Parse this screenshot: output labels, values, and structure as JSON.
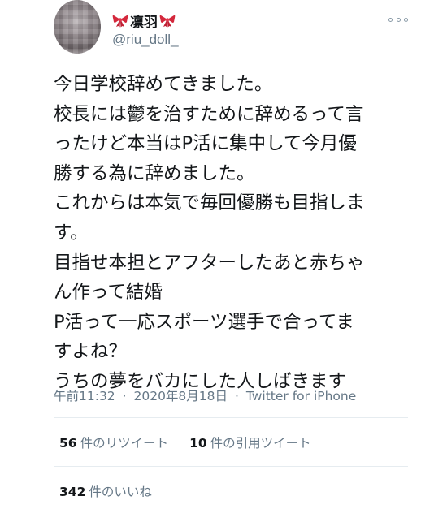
{
  "user": {
    "display_name": "凛羽",
    "handle": "@riu_doll_",
    "avatar_icon": "blurred-avatar",
    "ribbon_icon": "red-ribbon-emoji",
    "ribbon_color": "#d4283c"
  },
  "more_icon": "more-options-dots-icon",
  "tweet": {
    "lines": [
      "今日学校辞めてきました。",
      "校長には鬱を治すために辞めるって言",
      "ったけど本当はP活に集中して今月優",
      "勝する為に辞めました。",
      "これからは本気で毎回優勝も目指しま",
      "す。",
      "目指せ本担とアフターしたあと赤ちゃ",
      "ん作って結婚",
      "P活って一応スポーツ選手で合ってま",
      "すよね？",
      "うちの夢をバカにした人しばきます"
    ]
  },
  "meta": {
    "time": "午前11:32",
    "separator": "·",
    "date": "2020年8月18日",
    "source": "Twitter for iPhone"
  },
  "stats": {
    "retweets_count": "56",
    "retweets_label": "件のリツイート",
    "quotes_count": "10",
    "quotes_label": "件の引用ツイート",
    "likes_count": "342",
    "likes_label": "件のいいね"
  },
  "colors": {
    "text_primary": "#14171a",
    "text_secondary": "#657786",
    "divider": "#e6ecf0"
  }
}
